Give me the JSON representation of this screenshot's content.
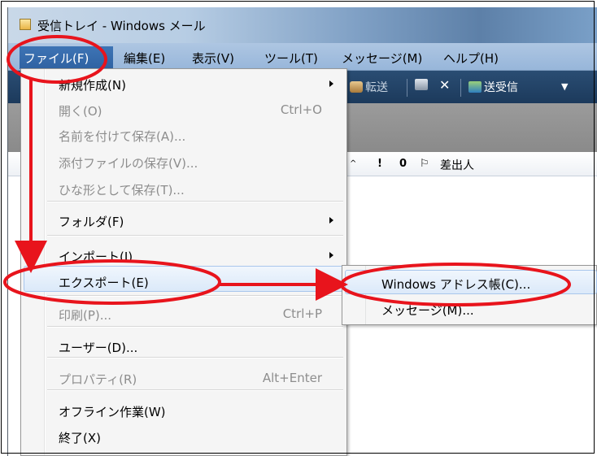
{
  "window": {
    "title": "受信トレイ - Windows メール"
  },
  "menubar": {
    "file": "ファイル(F)",
    "edit": "編集(E)",
    "view": "表示(V)",
    "tools": "ツール(T)",
    "message": "メッセージ(M)",
    "help": "ヘルプ(H)"
  },
  "toolbar": {
    "forward": "転送",
    "send_receive": "送受信",
    "delete_glyph": "✕",
    "dropdown_glyph": "▼"
  },
  "columns": {
    "sort_indicator": "^",
    "priority": "!",
    "attachment": "0",
    "flag": "⚐",
    "sender": "差出人"
  },
  "file_menu": {
    "items": [
      {
        "label": "新規作成(N)",
        "shortcut": "",
        "submenu": true,
        "enabled": true
      },
      {
        "label": "開く(O)",
        "shortcut": "Ctrl+O",
        "submenu": false,
        "enabled": false
      },
      {
        "label": "名前を付けて保存(A)...",
        "shortcut": "",
        "submenu": false,
        "enabled": false
      },
      {
        "label": "添付ファイルの保存(V)...",
        "shortcut": "",
        "submenu": false,
        "enabled": false
      },
      {
        "label": "ひな形として保存(T)...",
        "shortcut": "",
        "submenu": false,
        "enabled": false
      },
      {
        "label": "フォルダ(F)",
        "shortcut": "",
        "submenu": true,
        "enabled": true
      },
      {
        "label": "インポート(I)",
        "shortcut": "",
        "submenu": true,
        "enabled": true
      },
      {
        "label": "エクスポート(E)",
        "shortcut": "",
        "submenu": false,
        "enabled": true,
        "highlighted": true
      },
      {
        "label": "印刷(P)...",
        "shortcut": "Ctrl+P",
        "submenu": false,
        "enabled": false
      },
      {
        "label": "ユーザー(D)...",
        "shortcut": "",
        "submenu": false,
        "enabled": true
      },
      {
        "label": "プロパティ(R)",
        "shortcut": "Alt+Enter",
        "submenu": false,
        "enabled": false
      },
      {
        "label": "オフライン作業(W)",
        "shortcut": "",
        "submenu": false,
        "enabled": true
      },
      {
        "label": "終了(X)",
        "shortcut": "",
        "submenu": false,
        "enabled": true
      }
    ]
  },
  "export_submenu": {
    "items": [
      {
        "label": "Windows アドレス帳(C)...",
        "highlighted": true
      },
      {
        "label": "メッセージ(M)..."
      }
    ]
  },
  "colors": {
    "annotation_red": "#e8141c",
    "menu_highlight_border": "#a9c6ec",
    "menubar_selected": "#3e74b5",
    "toolbar_bg": "#1c3a5c"
  }
}
